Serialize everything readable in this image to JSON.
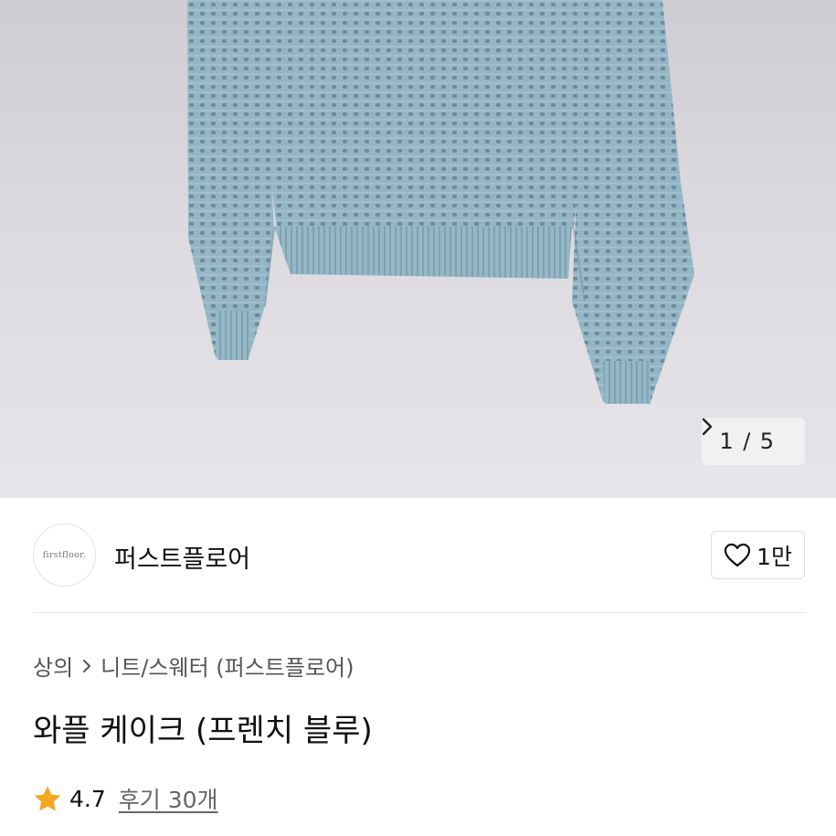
{
  "gallery": {
    "current_page": "1",
    "separator": "/",
    "total_pages": "5"
  },
  "brand": {
    "logo_text": "firstfloor.",
    "name": "퍼스트플로어"
  },
  "like": {
    "count_label": "1만"
  },
  "breadcrumb": {
    "category": "상의",
    "subcategory": "니트/스웨터 (퍼스트플로어)"
  },
  "product": {
    "title": "와플 케이크 (프렌치 블루)"
  },
  "rating": {
    "score": "4.7",
    "reviews_label": "후기 30개",
    "star_color": "#f5a623"
  },
  "colors": {
    "sweater": "#93b5c4",
    "background": "#dcdadf"
  }
}
